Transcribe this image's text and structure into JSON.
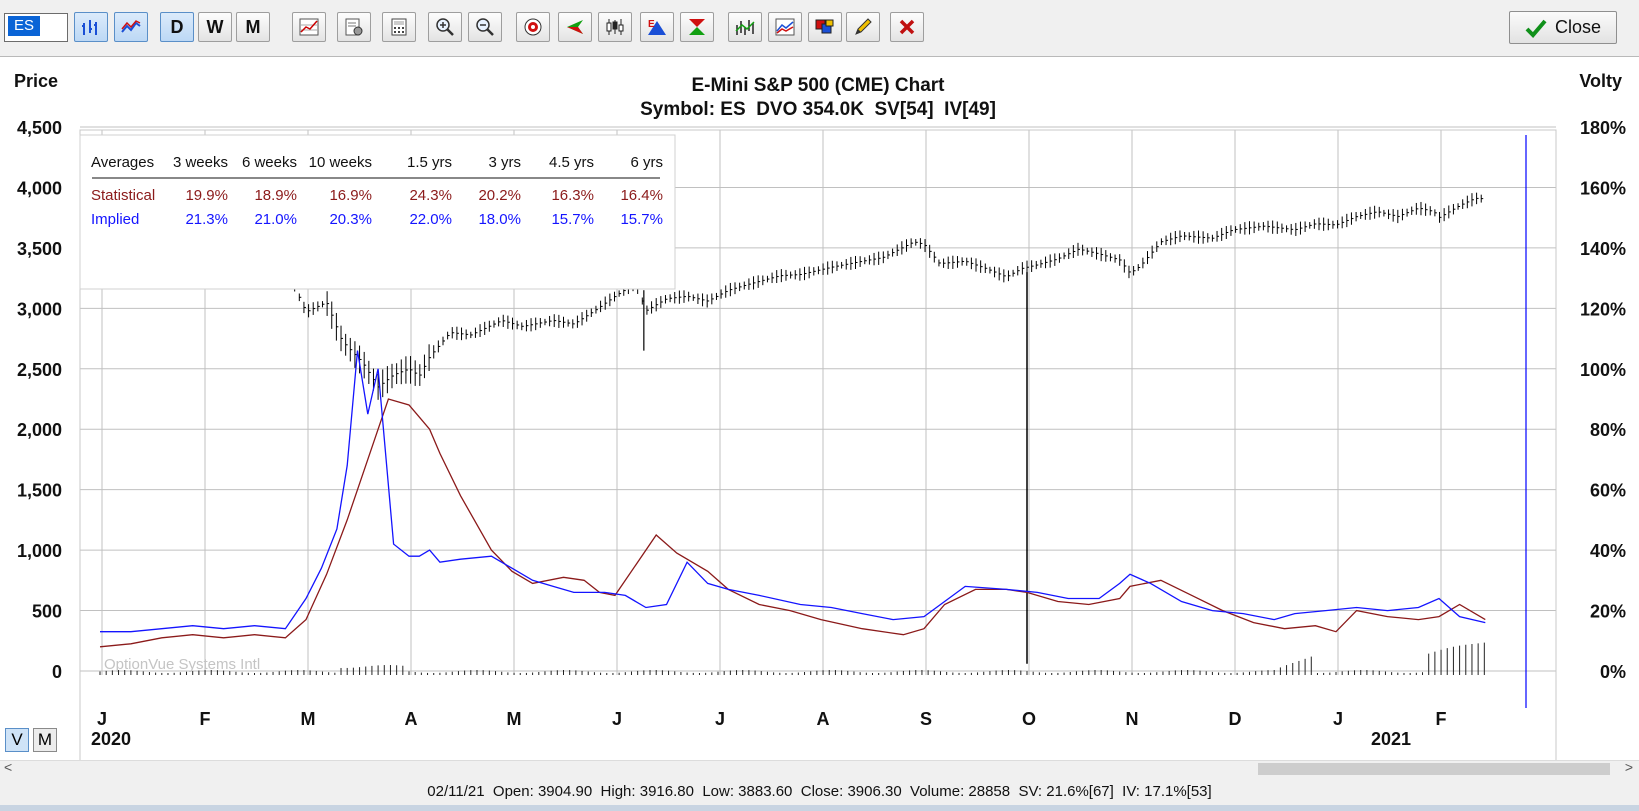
{
  "toolbar": {
    "symbol": "ES",
    "period_daily": "D",
    "period_weekly": "W",
    "period_monthly": "M",
    "close_label": "Close"
  },
  "chart": {
    "title": "E-Mini S&P 500 (CME) Chart",
    "subtitle": "Symbol: ES  DVO 354.0K  SV[54]  IV[49]",
    "left_axis_label": "Price",
    "right_axis_label": "Volty",
    "watermark": "OptionVue Systems Intl",
    "averages": {
      "headers": [
        "Averages",
        "3 weeks",
        "6 weeks",
        "10 weeks",
        "1.5 yrs",
        "3 yrs",
        "4.5 yrs",
        "6 yrs"
      ],
      "statistical": [
        "Statistical",
        "19.9%",
        "18.9%",
        "16.9%",
        "24.3%",
        "20.2%",
        "16.3%",
        "16.4%"
      ],
      "implied": [
        "Implied",
        "21.3%",
        "21.0%",
        "20.3%",
        "22.0%",
        "18.0%",
        "15.7%",
        "15.7%"
      ]
    },
    "colors": {
      "price": "#000000",
      "statistical": "#8b1a1a",
      "implied": "#1414ff",
      "cursor": "#0000ff",
      "grid": "#c0c0c0"
    }
  },
  "chart_data": {
    "type": "line",
    "title": "E-Mini S&P 500 (CME) Chart",
    "x_categories": [
      "J",
      "F",
      "M",
      "A",
      "M",
      "J",
      "J",
      "A",
      "S",
      "O",
      "N",
      "D",
      "J",
      "F"
    ],
    "years": [
      "2020",
      "2021"
    ],
    "left_axis": {
      "label": "Price",
      "ticks": [
        "4,500",
        "4,000",
        "3,500",
        "3,000",
        "2,500",
        "2,000",
        "1,500",
        "1,000",
        "500",
        "0"
      ],
      "range": [
        0,
        4500
      ]
    },
    "right_axis": {
      "label": "Volty",
      "ticks": [
        "180%",
        "160%",
        "140%",
        "120%",
        "100%",
        "80%",
        "60%",
        "40%",
        "20%",
        "0%"
      ],
      "range": [
        0,
        180
      ]
    },
    "series": [
      {
        "name": "Price",
        "unit": "price",
        "points": [
          [
            0.0,
            3230
          ],
          [
            0.5,
            3250
          ],
          [
            1.0,
            3290
          ],
          [
            1.3,
            3270
          ],
          [
            1.6,
            3330
          ],
          [
            1.75,
            3380
          ],
          [
            1.85,
            3250
          ],
          [
            2.0,
            2970
          ],
          [
            2.2,
            3050
          ],
          [
            2.35,
            2730
          ],
          [
            2.55,
            2550
          ],
          [
            2.7,
            2350
          ],
          [
            2.85,
            2450
          ],
          [
            3.0,
            2500
          ],
          [
            3.1,
            2440
          ],
          [
            3.2,
            2600
          ],
          [
            3.4,
            2800
          ],
          [
            3.6,
            2780
          ],
          [
            3.9,
            2900
          ],
          [
            4.1,
            2850
          ],
          [
            4.4,
            2900
          ],
          [
            4.6,
            2870
          ],
          [
            4.8,
            2980
          ],
          [
            5.0,
            3100
          ],
          [
            5.2,
            3210
          ],
          [
            5.3,
            2980
          ],
          [
            5.5,
            3080
          ],
          [
            5.7,
            3100
          ],
          [
            5.9,
            3060
          ],
          [
            6.1,
            3150
          ],
          [
            6.3,
            3200
          ],
          [
            6.6,
            3270
          ],
          [
            6.8,
            3280
          ],
          [
            7.1,
            3340
          ],
          [
            7.4,
            3390
          ],
          [
            7.6,
            3420
          ],
          [
            7.9,
            3550
          ],
          [
            8.0,
            3530
          ],
          [
            8.15,
            3370
          ],
          [
            8.4,
            3390
          ],
          [
            8.6,
            3330
          ],
          [
            8.8,
            3260
          ],
          [
            8.95,
            3330
          ],
          [
            9.1,
            3360
          ],
          [
            9.3,
            3410
          ],
          [
            9.5,
            3490
          ],
          [
            9.7,
            3450
          ],
          [
            9.9,
            3400
          ],
          [
            10.0,
            3290
          ],
          [
            10.1,
            3350
          ],
          [
            10.3,
            3550
          ],
          [
            10.5,
            3600
          ],
          [
            10.8,
            3580
          ],
          [
            11.0,
            3650
          ],
          [
            11.3,
            3680
          ],
          [
            11.6,
            3650
          ],
          [
            11.8,
            3700
          ],
          [
            12.0,
            3690
          ],
          [
            12.2,
            3760
          ],
          [
            12.4,
            3800
          ],
          [
            12.6,
            3760
          ],
          [
            12.8,
            3830
          ],
          [
            12.95,
            3800
          ],
          [
            13.0,
            3750
          ],
          [
            13.2,
            3850
          ],
          [
            13.35,
            3910
          ],
          [
            13.45,
            3906
          ]
        ]
      },
      {
        "name": "Statistical",
        "unit": "percent",
        "points": [
          [
            0.0,
            8
          ],
          [
            0.3,
            9
          ],
          [
            0.6,
            11
          ],
          [
            0.9,
            12
          ],
          [
            1.2,
            11
          ],
          [
            1.5,
            12
          ],
          [
            1.8,
            11
          ],
          [
            2.0,
            17
          ],
          [
            2.2,
            32
          ],
          [
            2.4,
            50
          ],
          [
            2.6,
            70
          ],
          [
            2.8,
            90
          ],
          [
            3.0,
            88
          ],
          [
            3.1,
            84
          ],
          [
            3.2,
            80
          ],
          [
            3.3,
            72
          ],
          [
            3.5,
            58
          ],
          [
            3.8,
            40
          ],
          [
            4.0,
            33
          ],
          [
            4.2,
            29
          ],
          [
            4.5,
            31
          ],
          [
            4.7,
            30
          ],
          [
            4.85,
            26
          ],
          [
            5.0,
            25
          ],
          [
            5.2,
            35
          ],
          [
            5.4,
            45
          ],
          [
            5.6,
            39
          ],
          [
            5.9,
            33
          ],
          [
            6.1,
            27
          ],
          [
            6.4,
            22
          ],
          [
            6.7,
            20
          ],
          [
            7.0,
            17
          ],
          [
            7.4,
            14
          ],
          [
            7.8,
            12
          ],
          [
            8.0,
            14
          ],
          [
            8.2,
            22
          ],
          [
            8.5,
            27
          ],
          [
            8.8,
            27
          ],
          [
            9.0,
            26
          ],
          [
            9.3,
            23
          ],
          [
            9.6,
            22
          ],
          [
            9.9,
            24
          ],
          [
            10.0,
            28
          ],
          [
            10.3,
            30
          ],
          [
            10.6,
            25
          ],
          [
            10.9,
            20
          ],
          [
            11.2,
            16
          ],
          [
            11.5,
            14
          ],
          [
            11.8,
            15
          ],
          [
            12.0,
            13
          ],
          [
            12.2,
            20
          ],
          [
            12.5,
            18
          ],
          [
            12.8,
            17
          ],
          [
            13.0,
            18
          ],
          [
            13.2,
            22
          ],
          [
            13.45,
            17
          ]
        ]
      },
      {
        "name": "Implied",
        "unit": "percent",
        "points": [
          [
            0.0,
            13
          ],
          [
            0.3,
            13
          ],
          [
            0.6,
            14
          ],
          [
            0.9,
            15
          ],
          [
            1.2,
            14
          ],
          [
            1.5,
            15
          ],
          [
            1.8,
            14
          ],
          [
            2.0,
            24
          ],
          [
            2.15,
            34
          ],
          [
            2.3,
            47
          ],
          [
            2.4,
            68
          ],
          [
            2.5,
            106
          ],
          [
            2.6,
            85
          ],
          [
            2.7,
            100
          ],
          [
            2.85,
            42
          ],
          [
            3.0,
            38
          ],
          [
            3.1,
            38
          ],
          [
            3.2,
            40
          ],
          [
            3.3,
            36
          ],
          [
            3.5,
            37
          ],
          [
            3.8,
            38
          ],
          [
            4.0,
            34
          ],
          [
            4.2,
            30
          ],
          [
            4.4,
            28
          ],
          [
            4.6,
            26
          ],
          [
            4.9,
            26
          ],
          [
            5.1,
            25
          ],
          [
            5.3,
            21
          ],
          [
            5.5,
            22
          ],
          [
            5.7,
            36
          ],
          [
            5.9,
            29
          ],
          [
            6.1,
            27
          ],
          [
            6.4,
            25
          ],
          [
            6.8,
            22
          ],
          [
            7.1,
            21
          ],
          [
            7.4,
            19
          ],
          [
            7.7,
            17
          ],
          [
            8.0,
            18
          ],
          [
            8.2,
            23
          ],
          [
            8.4,
            28
          ],
          [
            8.8,
            27
          ],
          [
            9.1,
            26
          ],
          [
            9.4,
            24
          ],
          [
            9.7,
            24
          ],
          [
            9.9,
            29
          ],
          [
            10.0,
            32
          ],
          [
            10.2,
            29
          ],
          [
            10.5,
            23
          ],
          [
            10.8,
            20
          ],
          [
            11.1,
            19
          ],
          [
            11.4,
            17
          ],
          [
            11.6,
            19
          ],
          [
            11.9,
            20
          ],
          [
            12.2,
            21
          ],
          [
            12.5,
            20
          ],
          [
            12.8,
            21
          ],
          [
            13.0,
            24
          ],
          [
            13.2,
            18
          ],
          [
            13.45,
            16
          ]
        ]
      }
    ],
    "volume_bars": "small columns along the bottom axis",
    "cursor_date": "02/11/21"
  },
  "view_mode": {
    "v": "V",
    "m": "M"
  },
  "status": {
    "date": "02/11/21",
    "open_label": "Open:",
    "open": "3904.90",
    "high_label": "High:",
    "high": "3916.80",
    "low_label": "Low:",
    "low": "3883.60",
    "close_label": "Close:",
    "close": "3906.30",
    "volume_label": "Volume:",
    "volume": "28858",
    "sv_label": "SV:",
    "sv": "21.6%[67]",
    "iv_label": "IV:",
    "iv": "17.1%[53]"
  },
  "scroll": {
    "left_arrow": "<",
    "right_arrow": ">"
  }
}
